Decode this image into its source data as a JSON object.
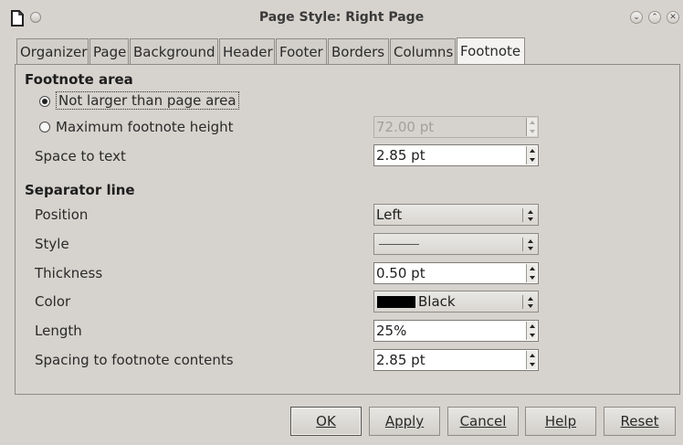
{
  "window": {
    "title": "Page Style: Right Page"
  },
  "tabs": [
    {
      "label": "Organizer"
    },
    {
      "label": "Page"
    },
    {
      "label": "Background"
    },
    {
      "label": "Header"
    },
    {
      "label": "Footer"
    },
    {
      "label": "Borders"
    },
    {
      "label": "Columns"
    },
    {
      "label": "Footnote",
      "active": true
    }
  ],
  "footnote_area": {
    "heading": "Footnote area",
    "radio_not_larger": {
      "label": "Not larger than page area",
      "selected": true
    },
    "radio_max_height": {
      "label": "Maximum footnote height",
      "selected": false,
      "value": "72.00 pt"
    },
    "space_to_text": {
      "label": "Space to text",
      "value": "2.85 pt"
    }
  },
  "separator_line": {
    "heading": "Separator line",
    "position": {
      "label": "Position",
      "value": "Left"
    },
    "style": {
      "label": "Style"
    },
    "thickness": {
      "label": "Thickness",
      "value": "0.50 pt"
    },
    "color": {
      "label": "Color",
      "value": "Black",
      "swatch": "#000000"
    },
    "length": {
      "label": "Length",
      "value": "25%"
    },
    "spacing": {
      "label": "Spacing to footnote contents",
      "value": "2.85 pt"
    }
  },
  "buttons": {
    "ok": "OK",
    "apply": "Apply",
    "cancel": "Cancel",
    "help": "Help",
    "reset": "Reset"
  }
}
